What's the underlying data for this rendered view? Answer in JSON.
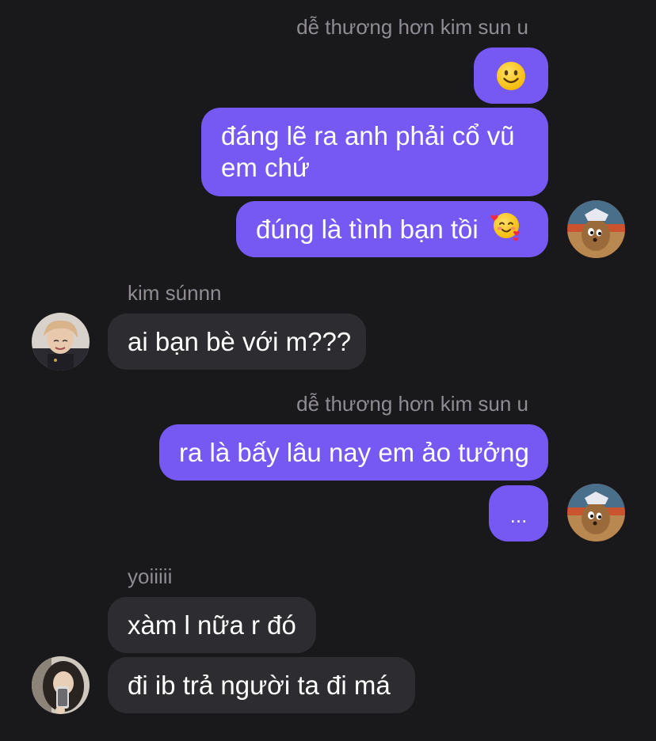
{
  "conversation": {
    "groups": [
      {
        "sender": "dễ thương hơn kim sun u",
        "messages": [
          {
            "emoji": "slightly-smiling-face"
          },
          {
            "text": "đáng lẽ ra anh phải cổ vũ",
            "text2": "em chứ"
          },
          {
            "text": "đúng là tình bạn tồi",
            "emoji": "smiling-face-with-hearts"
          }
        ],
        "avatar": "cartoon-mouse-avatar"
      },
      {
        "sender": "kim súnnn",
        "messages": [
          {
            "text": "ai bạn bè với m???"
          }
        ],
        "avatar": "person-photo-avatar"
      },
      {
        "sender": "dễ thương hơn kim sun u",
        "messages": [
          {
            "text": "ra là bấy lâu nay em ảo tưởng"
          },
          {
            "text": "..."
          }
        ],
        "avatar": "cartoon-mouse-avatar"
      },
      {
        "sender": "yoiiiii",
        "messages": [
          {
            "text": "xàm l nữa r đó"
          },
          {
            "text": "đi ib trả người ta đi má"
          }
        ],
        "avatar": "person-selfie-avatar"
      }
    ]
  },
  "colors": {
    "background": "#19181b",
    "outgoing_bubble": "#7559f2",
    "incoming_bubble": "#2d2c30",
    "sender_name": "#8f8d93"
  }
}
